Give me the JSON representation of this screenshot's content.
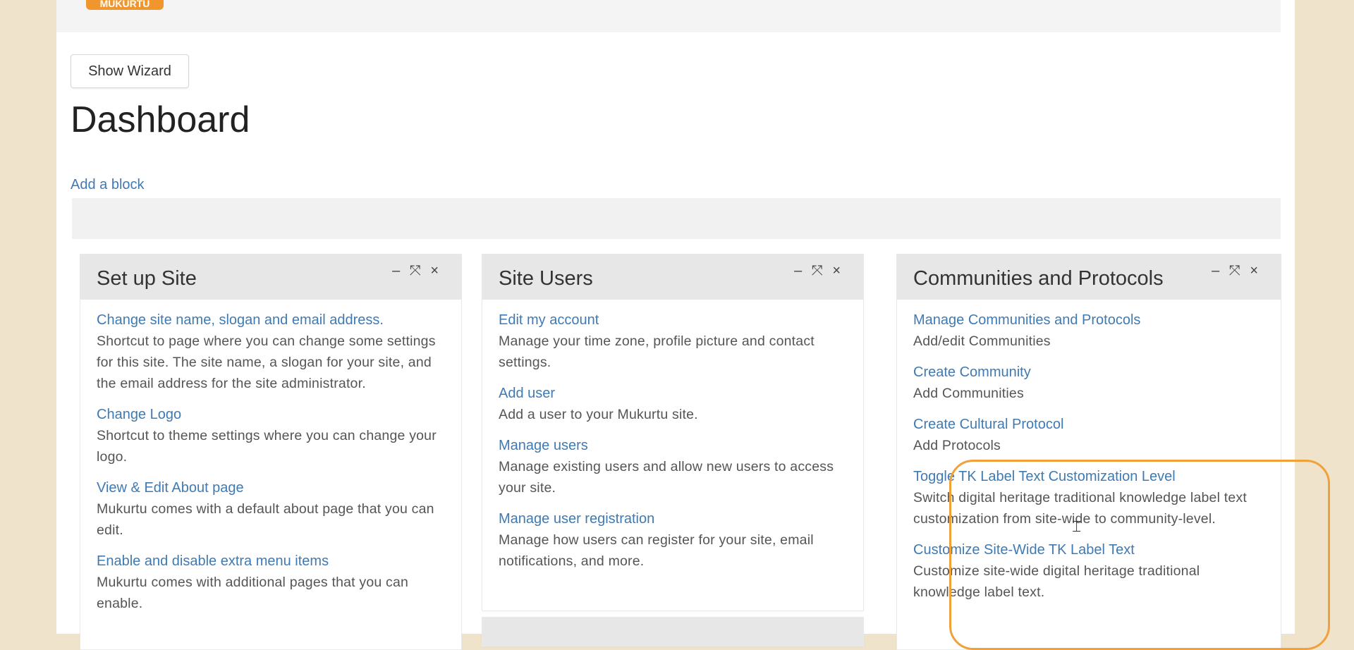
{
  "header": {
    "logo_text": "MUKURTU"
  },
  "toolbar": {
    "show_wizard_label": "Show Wizard"
  },
  "page_title": "Dashboard",
  "add_block_label": "Add a block",
  "blocks": [
    {
      "title": "Set up Site",
      "controls": [
        "–",
        "⤧",
        "×"
      ],
      "items": [
        {
          "link": "Change site name, slogan and email address.",
          "desc": "Shortcut to page where you can change some settings for this site. The site name, a slogan for your site, and the email address for the site administrator."
        },
        {
          "link": "Change Logo",
          "desc": "Shortcut to theme settings where you can change your logo."
        },
        {
          "link": "View & Edit About page",
          "desc": "Mukurtu comes with a default about page that you can edit."
        },
        {
          "link": "Enable and disable extra menu items",
          "desc": "Mukurtu comes with additional pages that you can enable."
        }
      ]
    },
    {
      "title": "Site Users",
      "controls": [
        "–",
        "⤧",
        "×"
      ],
      "items": [
        {
          "link": "Edit my account",
          "desc": "Manage your time zone, profile picture and contact settings."
        },
        {
          "link": "Add user",
          "desc": "Add a user to your Mukurtu site."
        },
        {
          "link": "Manage users",
          "desc": "Manage existing users and allow new users to access your site."
        },
        {
          "link": "Manage user registration",
          "desc": "Manage how users can register for your site, email notifications, and more."
        }
      ]
    },
    {
      "title": "Communities and Protocols",
      "controls": [
        "–",
        "⤧",
        "×"
      ],
      "items": [
        {
          "link": "Manage Communities and Protocols",
          "desc": "Add/edit Communities"
        },
        {
          "link": "Create Community",
          "desc": "Add Communities"
        },
        {
          "link": "Create Cultural Protocol",
          "desc": "Add Protocols"
        },
        {
          "link": "Toggle TK Label Text Customization Level",
          "desc": "Switch digital heritage traditional knowledge label text customization from site-wide to community-level."
        },
        {
          "link": "Customize Site-Wide TK Label Text",
          "desc": "Customize site-wide digital heritage traditional knowledge label text."
        }
      ]
    }
  ],
  "colors": {
    "link": "#3f7ab3",
    "highlight": "#f0a13a",
    "background": "#efe3cb"
  }
}
